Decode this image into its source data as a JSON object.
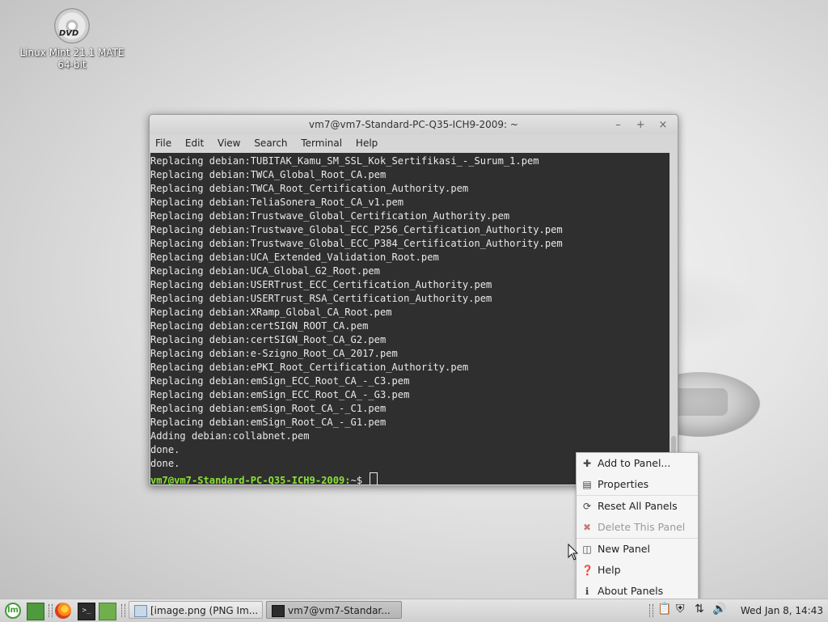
{
  "desktop": {
    "icon": {
      "disc_label": "DVD",
      "label_line1": "Linux Mint 21.1 MATE",
      "label_line2": "64-bit"
    }
  },
  "terminal": {
    "title": "vm7@vm7-Standard-PC-Q35-ICH9-2009: ~",
    "controls": {
      "minimize": "–",
      "maximize": "+",
      "close": "×"
    },
    "menu": [
      "File",
      "Edit",
      "View",
      "Search",
      "Terminal",
      "Help"
    ],
    "lines": [
      "Replacing debian:TUBITAK_Kamu_SM_SSL_Kok_Sertifikasi_-_Surum_1.pem",
      "Replacing debian:TWCA_Global_Root_CA.pem",
      "Replacing debian:TWCA_Root_Certification_Authority.pem",
      "Replacing debian:TeliaSonera_Root_CA_v1.pem",
      "Replacing debian:Trustwave_Global_Certification_Authority.pem",
      "Replacing debian:Trustwave_Global_ECC_P256_Certification_Authority.pem",
      "Replacing debian:Trustwave_Global_ECC_P384_Certification_Authority.pem",
      "Replacing debian:UCA_Extended_Validation_Root.pem",
      "Replacing debian:UCA_Global_G2_Root.pem",
      "Replacing debian:USERTrust_ECC_Certification_Authority.pem",
      "Replacing debian:USERTrust_RSA_Certification_Authority.pem",
      "Replacing debian:XRamp_Global_CA_Root.pem",
      "Replacing debian:certSIGN_ROOT_CA.pem",
      "Replacing debian:certSIGN_Root_CA_G2.pem",
      "Replacing debian:e-Szigno_Root_CA_2017.pem",
      "Replacing debian:ePKI_Root_Certification_Authority.pem",
      "Replacing debian:emSign_ECC_Root_CA_-_C3.pem",
      "Replacing debian:emSign_ECC_Root_CA_-_G3.pem",
      "Replacing debian:emSign_Root_CA_-_C1.pem",
      "Replacing debian:emSign_Root_CA_-_G1.pem",
      "Adding debian:collabnet.pem",
      "done.",
      "done."
    ],
    "prompt": "vm7@vm7-Standard-PC-Q35-ICH9-2009:",
    "prompt_suffix": "~$"
  },
  "context_menu": {
    "items": [
      {
        "label": "Add to Panel...",
        "icon": "plus-icon",
        "glyph": "✚",
        "enabled": true
      },
      {
        "label": "Properties",
        "icon": "properties-icon",
        "glyph": "▤",
        "enabled": true
      },
      {
        "label": "Reset All Panels",
        "icon": "reset-icon",
        "glyph": "⟳",
        "enabled": true
      },
      {
        "label": "Delete This Panel",
        "icon": "delete-icon",
        "glyph": "✖",
        "enabled": false
      },
      {
        "label": "New Panel",
        "icon": "new-panel-icon",
        "glyph": "◫",
        "enabled": true
      },
      {
        "label": "Help",
        "icon": "help-icon",
        "glyph": "❓",
        "enabled": true
      },
      {
        "label": "About Panels",
        "icon": "about-icon",
        "glyph": "ℹ",
        "enabled": true
      }
    ]
  },
  "panel": {
    "menu_glyph": "lm",
    "term_glyph": ">_",
    "tasks": [
      {
        "label": "[image.png (PNG Im...",
        "icon": "image-viewer-icon",
        "active": false
      },
      {
        "label": "vm7@vm7-Standar...",
        "icon": "terminal-icon",
        "active": true
      }
    ],
    "tray": {
      "clipboard": "📋",
      "shield": "⛨",
      "network": "⇅",
      "volume": "🔊"
    },
    "clock": "Wed Jan  8, 14:43"
  },
  "colors": {
    "terminal_bg": "#2f2f2f",
    "terminal_fg": "#e9e9e9",
    "prompt_green": "#8ae234",
    "mint_green": "#3f9c35"
  }
}
